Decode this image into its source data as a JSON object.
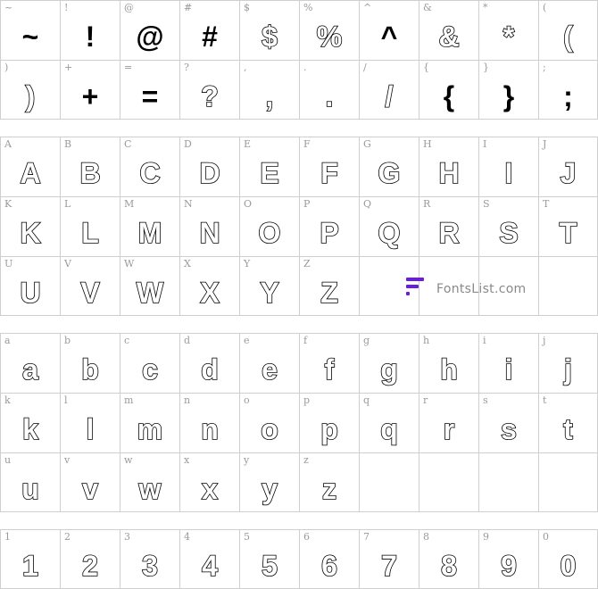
{
  "sections": [
    {
      "id": "symbols",
      "cells": [
        {
          "label": "~",
          "glyph": "~",
          "solid": true
        },
        {
          "label": "!",
          "glyph": "!",
          "solid": true
        },
        {
          "label": "@",
          "glyph": "@",
          "solid": true
        },
        {
          "label": "#",
          "glyph": "#",
          "solid": true
        },
        {
          "label": "$",
          "glyph": "$",
          "solid": false
        },
        {
          "label": "%",
          "glyph": "%",
          "solid": false
        },
        {
          "label": "^",
          "glyph": "^",
          "solid": true
        },
        {
          "label": "&",
          "glyph": "&",
          "solid": false
        },
        {
          "label": "*",
          "glyph": "*",
          "solid": false
        },
        {
          "label": "(",
          "glyph": "(",
          "solid": false
        },
        {
          "label": ")",
          "glyph": ")",
          "solid": false
        },
        {
          "label": "+",
          "glyph": "+",
          "solid": true
        },
        {
          "label": "=",
          "glyph": "=",
          "solid": true
        },
        {
          "label": "?",
          "glyph": "?",
          "solid": false
        },
        {
          "label": ",",
          "glyph": ",",
          "solid": false
        },
        {
          "label": ".",
          "glyph": ".",
          "solid": false
        },
        {
          "label": "/",
          "glyph": "/",
          "solid": false
        },
        {
          "label": "{",
          "glyph": "{",
          "solid": true
        },
        {
          "label": "}",
          "glyph": "}",
          "solid": true
        },
        {
          "label": ";",
          "glyph": ";",
          "solid": true
        }
      ]
    },
    {
      "id": "uppercase",
      "cells": [
        {
          "label": "A",
          "glyph": "A"
        },
        {
          "label": "B",
          "glyph": "B"
        },
        {
          "label": "C",
          "glyph": "C"
        },
        {
          "label": "D",
          "glyph": "D"
        },
        {
          "label": "E",
          "glyph": "E"
        },
        {
          "label": "F",
          "glyph": "F"
        },
        {
          "label": "G",
          "glyph": "G"
        },
        {
          "label": "H",
          "glyph": "H"
        },
        {
          "label": "I",
          "glyph": "I"
        },
        {
          "label": "J",
          "glyph": "J"
        },
        {
          "label": "K",
          "glyph": "K"
        },
        {
          "label": "L",
          "glyph": "L"
        },
        {
          "label": "M",
          "glyph": "M"
        },
        {
          "label": "N",
          "glyph": "N"
        },
        {
          "label": "O",
          "glyph": "O"
        },
        {
          "label": "P",
          "glyph": "P"
        },
        {
          "label": "Q",
          "glyph": "Q"
        },
        {
          "label": "R",
          "glyph": "R"
        },
        {
          "label": "S",
          "glyph": "S"
        },
        {
          "label": "T",
          "glyph": "T"
        },
        {
          "label": "U",
          "glyph": "U"
        },
        {
          "label": "V",
          "glyph": "V"
        },
        {
          "label": "W",
          "glyph": "W"
        },
        {
          "label": "X",
          "glyph": "X"
        },
        {
          "label": "Y",
          "glyph": "Y"
        },
        {
          "label": "Z",
          "glyph": "Z"
        }
      ]
    },
    {
      "id": "lowercase",
      "cells": [
        {
          "label": "a",
          "glyph": "a"
        },
        {
          "label": "b",
          "glyph": "b"
        },
        {
          "label": "c",
          "glyph": "c"
        },
        {
          "label": "d",
          "glyph": "d"
        },
        {
          "label": "e",
          "glyph": "e"
        },
        {
          "label": "f",
          "glyph": "f"
        },
        {
          "label": "g",
          "glyph": "g"
        },
        {
          "label": "h",
          "glyph": "h"
        },
        {
          "label": "i",
          "glyph": "i"
        },
        {
          "label": "j",
          "glyph": "j"
        },
        {
          "label": "k",
          "glyph": "k"
        },
        {
          "label": "l",
          "glyph": "l"
        },
        {
          "label": "m",
          "glyph": "m"
        },
        {
          "label": "n",
          "glyph": "n"
        },
        {
          "label": "o",
          "glyph": "o"
        },
        {
          "label": "p",
          "glyph": "p"
        },
        {
          "label": "q",
          "glyph": "q"
        },
        {
          "label": "r",
          "glyph": "r"
        },
        {
          "label": "s",
          "glyph": "s"
        },
        {
          "label": "t",
          "glyph": "t"
        },
        {
          "label": "u",
          "glyph": "u"
        },
        {
          "label": "v",
          "glyph": "v"
        },
        {
          "label": "w",
          "glyph": "w"
        },
        {
          "label": "x",
          "glyph": "x"
        },
        {
          "label": "y",
          "glyph": "y"
        },
        {
          "label": "z",
          "glyph": "z"
        }
      ]
    },
    {
      "id": "digits",
      "cells": [
        {
          "label": "1",
          "glyph": "1"
        },
        {
          "label": "2",
          "glyph": "2"
        },
        {
          "label": "3",
          "glyph": "3"
        },
        {
          "label": "4",
          "glyph": "4"
        },
        {
          "label": "5",
          "glyph": "5"
        },
        {
          "label": "6",
          "glyph": "6"
        },
        {
          "label": "7",
          "glyph": "7"
        },
        {
          "label": "8",
          "glyph": "8"
        },
        {
          "label": "9",
          "glyph": "9"
        },
        {
          "label": "0",
          "glyph": "0"
        }
      ]
    }
  ],
  "watermark": {
    "text": "FontsList.com",
    "logo_icon": "fontslist-logo-icon",
    "color": "#6a1de0"
  }
}
